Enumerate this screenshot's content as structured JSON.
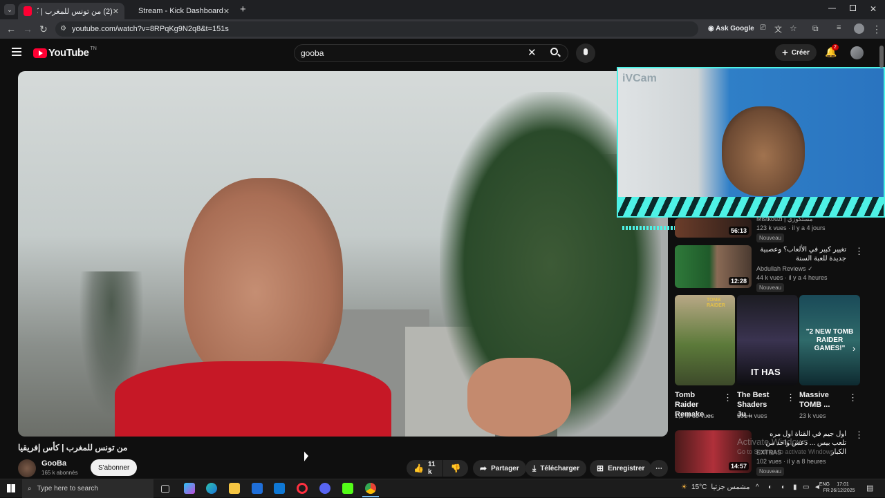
{
  "browser": {
    "tabs": [
      {
        "label": "(2) من تونس للمغرب | كأس",
        "active": true
      },
      {
        "label": "Stream - Kick Dashboard",
        "active": false
      }
    ],
    "url": "youtube.com/watch?v=8RPqKg9N2q8&t=151s",
    "ask_google": "Ask Google"
  },
  "header": {
    "logo_text": "YouTube",
    "logo_sup": "TN",
    "search_value": "gooba",
    "create_label": "Créer",
    "notification_count": "2"
  },
  "webcam": {
    "label": "iVCam"
  },
  "video": {
    "title": "من تونس للمغرب | كأس إفريقيا",
    "channel": "GooBa",
    "subscribers": "165 k abonnés",
    "subscribe_label": "S'abonner",
    "likes": "11 k",
    "share_label": "Partager",
    "download_label": "Télécharger",
    "save_label": "Enregistrer"
  },
  "sidebar": {
    "rec1": {
      "channel": "Mistkouzi | مستكوزي",
      "meta": "123 k vues · il y a 4 jours",
      "duration": "56:13",
      "badge": "Nouveau"
    },
    "rec2": {
      "title": "تغيير كبير في الألعاب؟ وعصبية جديدة للعبة السنة",
      "channel": "Abdullah Reviews",
      "meta": "44 k vues · il y a 4 heures",
      "duration": "12:28",
      "badge": "Nouveau"
    },
    "shorts": [
      {
        "title": "Tomb Raider Remake ...",
        "views": "1,2 M de vues",
        "thumb_text": "TOMB RAIDER"
      },
      {
        "title": "The Best Shaders Ju...",
        "views": "501 k vues",
        "thumb_text": "IT HAS"
      },
      {
        "title": "Massive TOMB ...",
        "views": "23 k vues",
        "thumb_text": "\"2 NEW TOMB RAIDER GAMES!\""
      }
    ],
    "rec3": {
      "title": "اول جيم في القناة اول مره تلعب بيس ... دعس واحد من الكبار",
      "channel": "EXTRAS",
      "meta": "102 vues · il y a 8 heures",
      "duration": "14:57",
      "badge": "Nouveau"
    },
    "watermark_line1": "Activate Windows",
    "watermark_line2": "Go to Settings to activate Windows."
  },
  "taskbar": {
    "search_placeholder": "Type here to search",
    "weather": "15°C",
    "weather_desc": "مشمس جزئيا",
    "lang1": "ENG",
    "lang2": "FR",
    "time": "17:01",
    "date": "26/12/2025"
  }
}
